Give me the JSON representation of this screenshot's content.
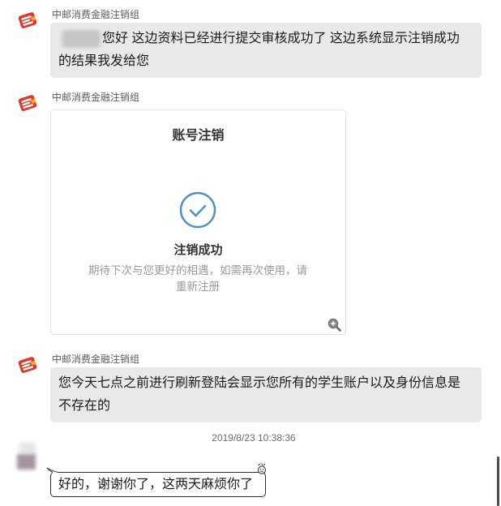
{
  "chat": {
    "messages": [
      {
        "sender": "中邮消费金融注销组",
        "text": "您好 这边资料已经进行提交审核成功了 这边系统显示注销成功的结果我发给您"
      },
      {
        "sender": "中邮消费金融注销组",
        "image_card": {
          "title": "账号注销",
          "status": "注销成功",
          "description": "期待下次与您更好的相遇，如需再次使用，请重新注册"
        }
      },
      {
        "sender": "中邮消费金融注销组",
        "text": "您今天七点之前进行刷新登陆会显示您所有的学生账户以及身份信息是不存在的"
      }
    ],
    "timestamp": "2019/8/23 10:38:36",
    "reply": {
      "text": "好的，谢谢你了，这两天麻烦你了"
    }
  },
  "icons": {
    "sender_avatar": "china-post-logo-icon",
    "success": "check-circle-icon",
    "image_zoom": "zoom-in-icon",
    "reply_decoration": "emoji-icon"
  },
  "colors": {
    "page_background": "#ffffff",
    "incoming_bubble": "#e9e9e9",
    "outgoing_bubble": "#ffffff",
    "outgoing_border": "#2e2e2e",
    "success_accent": "#4f8fcb",
    "brand_red": "#e2372b"
  }
}
